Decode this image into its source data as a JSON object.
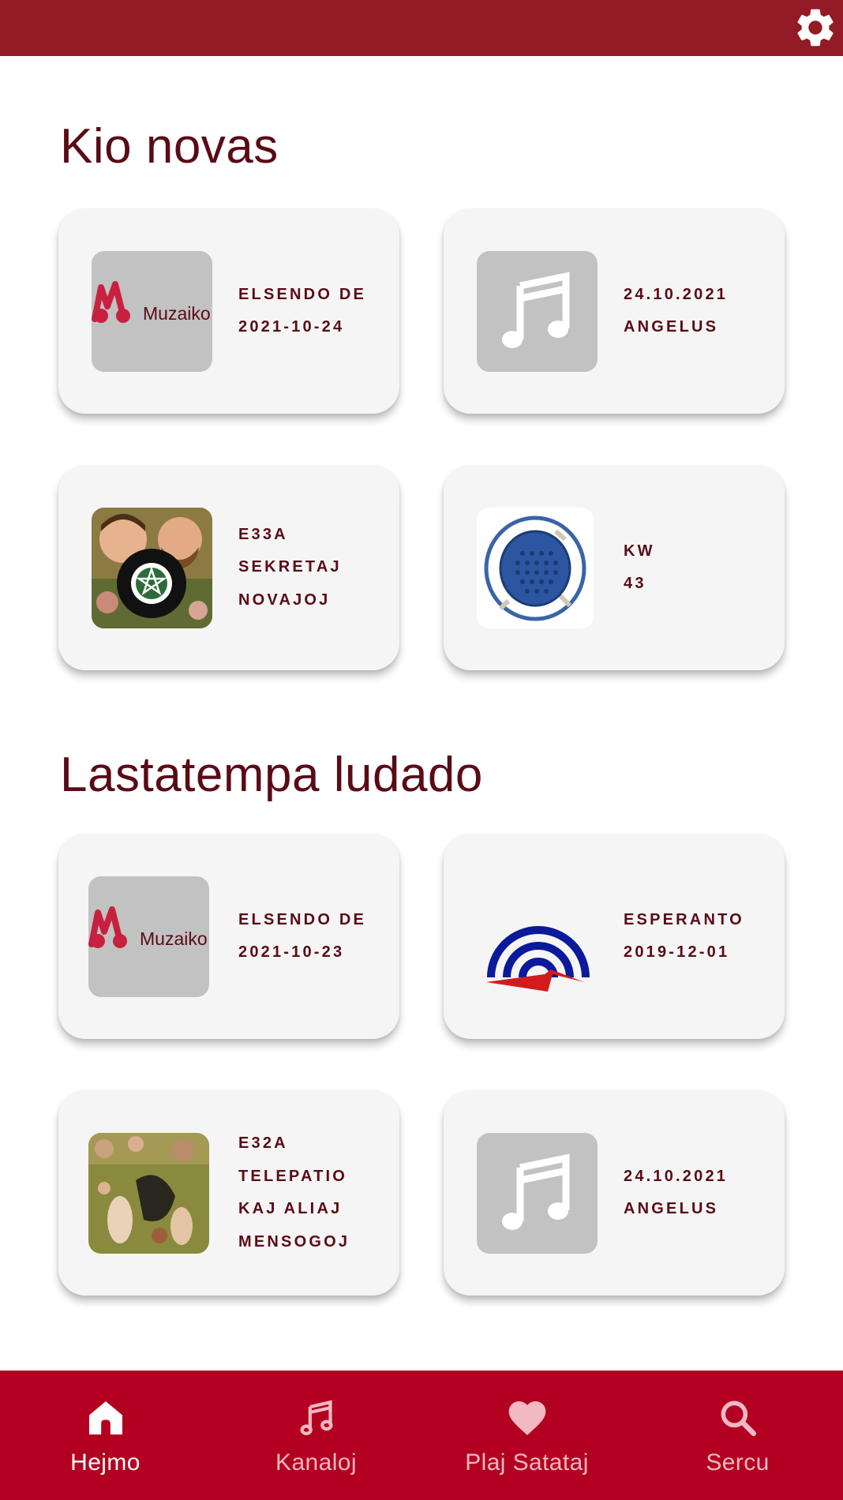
{
  "header": {
    "settings_icon": "gear-icon",
    "background": "#921b26"
  },
  "sections": [
    {
      "title": "Kio novas",
      "cards": [
        {
          "image": "muzaiko-logo",
          "logo_text": "Muzaiko",
          "lines": [
            "ELSENDO DE",
            "2021-10-24"
          ]
        },
        {
          "image": "music-note-placeholder",
          "lines": [
            "24.10.2021",
            "ANGELUS"
          ]
        },
        {
          "image": "podcast-cover-la-malfamuloj",
          "lines": [
            "E33A",
            "SEKRETAJ",
            "NOVAJOJ"
          ]
        },
        {
          "image": "radio-speaker-icon",
          "lines": [
            "KW",
            "43"
          ]
        }
      ]
    },
    {
      "title": "Lastatempa ludado",
      "cards": [
        {
          "image": "muzaiko-logo",
          "logo_text": "Muzaiko",
          "lines": [
            "ELSENDO DE",
            "2021-10-23"
          ]
        },
        {
          "image": "broadcast-arc-logo",
          "lines": [
            "ESPERANTO",
            "2019-12-01"
          ]
        },
        {
          "image": "painting-cover",
          "lines": [
            "E32A",
            "TELEPATIO",
            "KAJ ALIAJ",
            "MENSOGOJ"
          ]
        },
        {
          "image": "music-note-placeholder",
          "lines": [
            "24.10.2021",
            "ANGELUS"
          ]
        }
      ]
    }
  ],
  "bottom_nav": {
    "background": "#b30021",
    "items": [
      {
        "label": "Hejmo",
        "icon": "home-icon",
        "active": true
      },
      {
        "label": "Kanaloj",
        "icon": "music-note-icon",
        "active": false
      },
      {
        "label": "Plaj Satataj",
        "icon": "heart-icon",
        "active": false
      },
      {
        "label": "Sercu",
        "icon": "search-icon",
        "active": false
      }
    ]
  },
  "colors": {
    "title": "#5a0b16",
    "card_bg": "#f5f5f5",
    "nav_active": "#ffffff",
    "nav_inactive": "#f2b8c3"
  }
}
